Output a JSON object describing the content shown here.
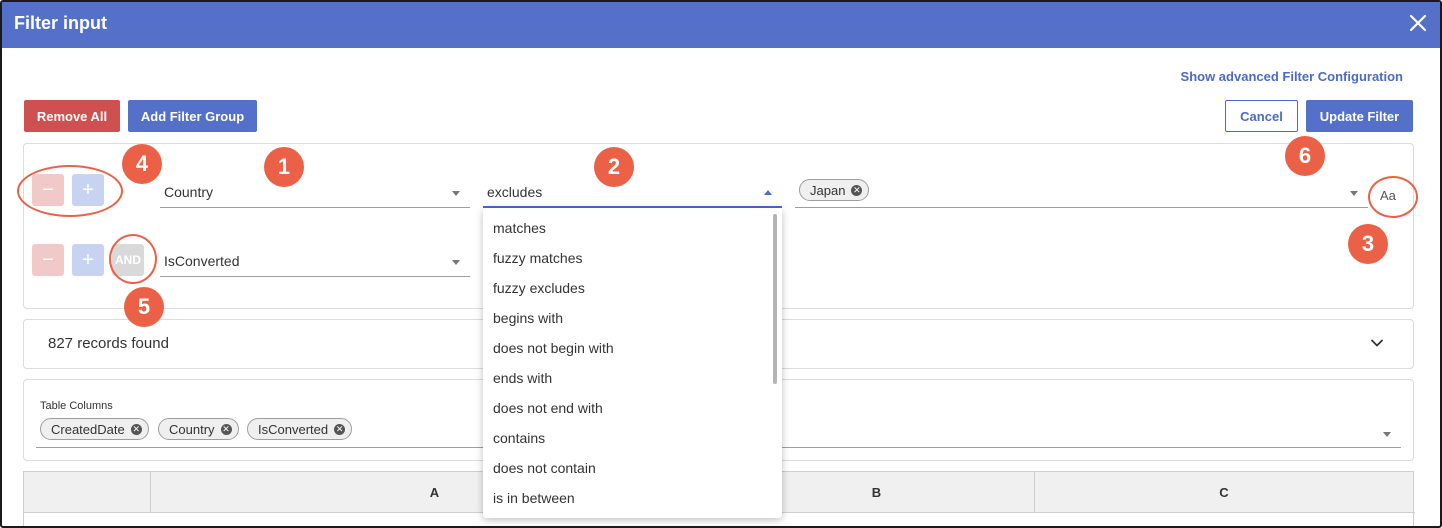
{
  "dialog": {
    "title": "Filter input",
    "close_icon": "close-icon"
  },
  "links": {
    "advanced": "Show advanced Filter Configuration"
  },
  "toolbar": {
    "remove_all": "Remove All",
    "add_filter_group": "Add Filter Group",
    "cancel": "Cancel",
    "update_filter": "Update Filter"
  },
  "filters": {
    "row1": {
      "minus": "−",
      "plus": "+",
      "field": "Country",
      "operator": "excludes",
      "value_chip": "Japan",
      "case_toggle": "Aa"
    },
    "row2": {
      "minus": "−",
      "plus": "+",
      "logic": "AND",
      "field": "IsConverted"
    }
  },
  "operator_options": [
    "matches",
    "fuzzy matches",
    "fuzzy excludes",
    "begins with",
    "does not begin with",
    "ends with",
    "does not end with",
    "contains",
    "does not contain",
    "is in between"
  ],
  "records": {
    "text": "827 records found"
  },
  "table_columns": {
    "label": "Table Columns",
    "chips": [
      "CreatedDate",
      "Country",
      "IsConverted"
    ]
  },
  "grid": {
    "headers": [
      "",
      "A",
      "B",
      "C"
    ]
  },
  "annotations": [
    "1",
    "2",
    "3",
    "4",
    "5",
    "6"
  ],
  "colors": {
    "accent": "#5470c8",
    "danger": "#cf5050",
    "annotation": "#eb6148"
  }
}
